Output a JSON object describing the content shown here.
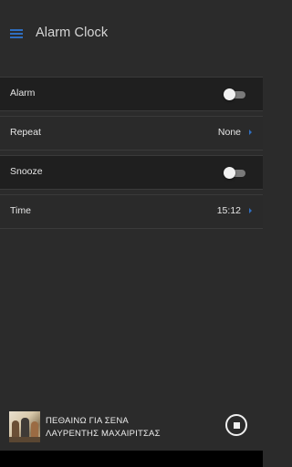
{
  "appbar": {
    "title": "Alarm Clock",
    "menu_icon": "hamburger-menu-icon",
    "accent": "#2f6ec0"
  },
  "settings": [
    {
      "label": "Alarm",
      "type": "toggle",
      "on": false
    },
    {
      "label": "Repeat",
      "type": "select",
      "value": "None"
    },
    {
      "label": "Snooze",
      "type": "toggle",
      "on": false
    },
    {
      "label": "Time",
      "type": "select",
      "value": "15:12"
    }
  ],
  "player": {
    "track_title": "ΠΕΘΑΙΝΩ ΓΙΑ ΣΕΝΑ",
    "artist": "ΛΑΥΡΕΝΤΗΣ ΜΑΧΑΙΡΙΤΣΑΣ",
    "control_icon": "stop-icon"
  },
  "colors": {
    "background": "#2b2b2b",
    "row_dark": "#1f1f1f",
    "text": "#e6e6e6",
    "accent": "#2f6ec0"
  }
}
